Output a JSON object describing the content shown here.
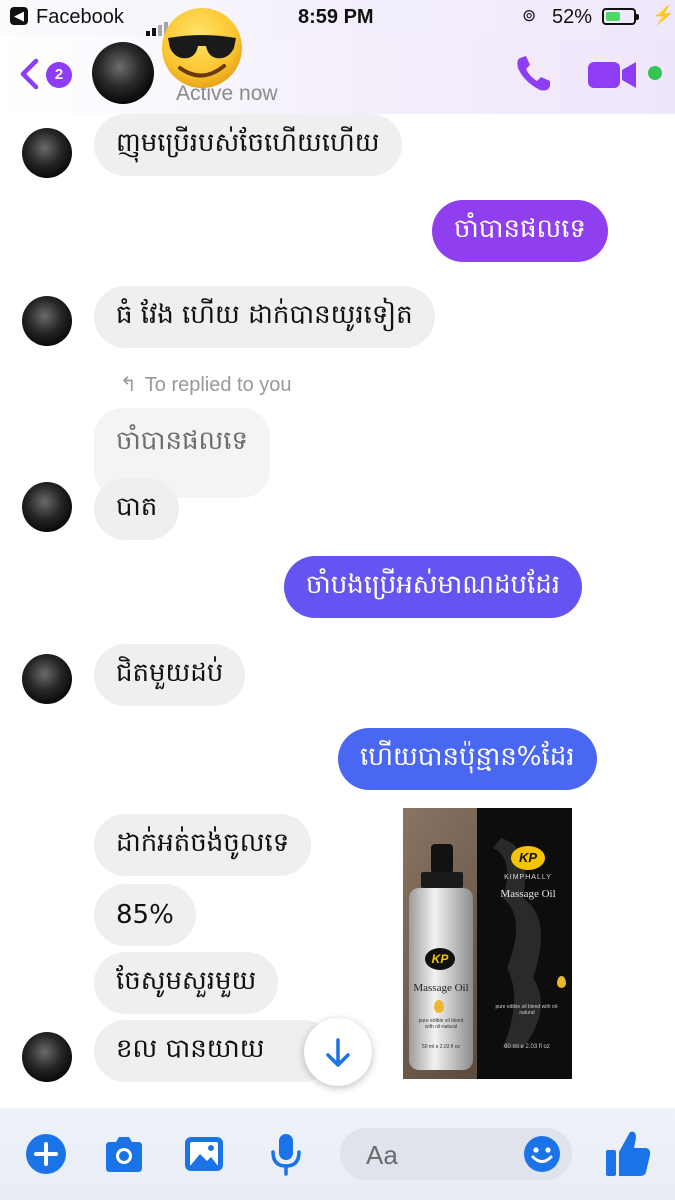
{
  "status_bar": {
    "back_app": "Facebook",
    "time": "8:59 PM",
    "battery_percent": "52%",
    "battery_level": 0.52
  },
  "header": {
    "unread_count": "2",
    "active_status": "Active now",
    "overlay_emoji": "😎"
  },
  "messages": [
    {
      "from": "them",
      "text": "ញុមប្រើរបស់ចែហើយហើយ"
    },
    {
      "from": "me",
      "text": "ចាំបានផលទេ"
    },
    {
      "from": "them",
      "text": "ធំ វែង ហើយ ដាក់បានយូរទៀត"
    },
    {
      "from": "them",
      "reply_label": "To replied to you",
      "quoted": "ចាំបានផលទេ",
      "text": "បាត"
    },
    {
      "from": "me",
      "text": "ចាំបងប្រើអស់មាណដបដែរ"
    },
    {
      "from": "them",
      "text": "ជិតមួយដប់"
    },
    {
      "from": "me",
      "text": "ហើយបានប៉ុន្មាន%ដែរ"
    },
    {
      "from": "them",
      "text": "ដាក់អត់ចង់ចូលទេ"
    },
    {
      "from": "them",
      "text": "85%"
    },
    {
      "from": "them",
      "text": "ចែសូមសួរមួយ"
    },
    {
      "from": "them",
      "text": "ខល បានយាយ"
    }
  ],
  "product_image": {
    "brand": "KP",
    "brand_name": "KIMPHALLY",
    "product_name": "Massage Oil",
    "box_blend": "pure edible oil blend with oil-natural",
    "box_volume": "60 ml e 2.03 fl oz",
    "bottle_blend": "pure edible oil blend with oil-natural",
    "bottle_volume": "50 ml e 2.03 fl oz"
  },
  "composer": {
    "placeholder": "Aa"
  },
  "icons": [
    "back-chevron-icon",
    "phone-icon",
    "video-camera-icon",
    "plus-icon",
    "camera-icon",
    "gallery-icon",
    "microphone-icon",
    "emoji-icon",
    "thumbs-up-icon",
    "arrow-down-icon",
    "reply-arrow-icon"
  ],
  "colors": {
    "accent_purple": "#8f3cf7",
    "bubble_out_1": "#8f3ff0",
    "bubble_out_2": "#6454f2",
    "bubble_out_3": "#4a67f4",
    "bubble_in": "#efefef",
    "composer_blue": "#1b73e8",
    "online_green": "#33c653"
  }
}
